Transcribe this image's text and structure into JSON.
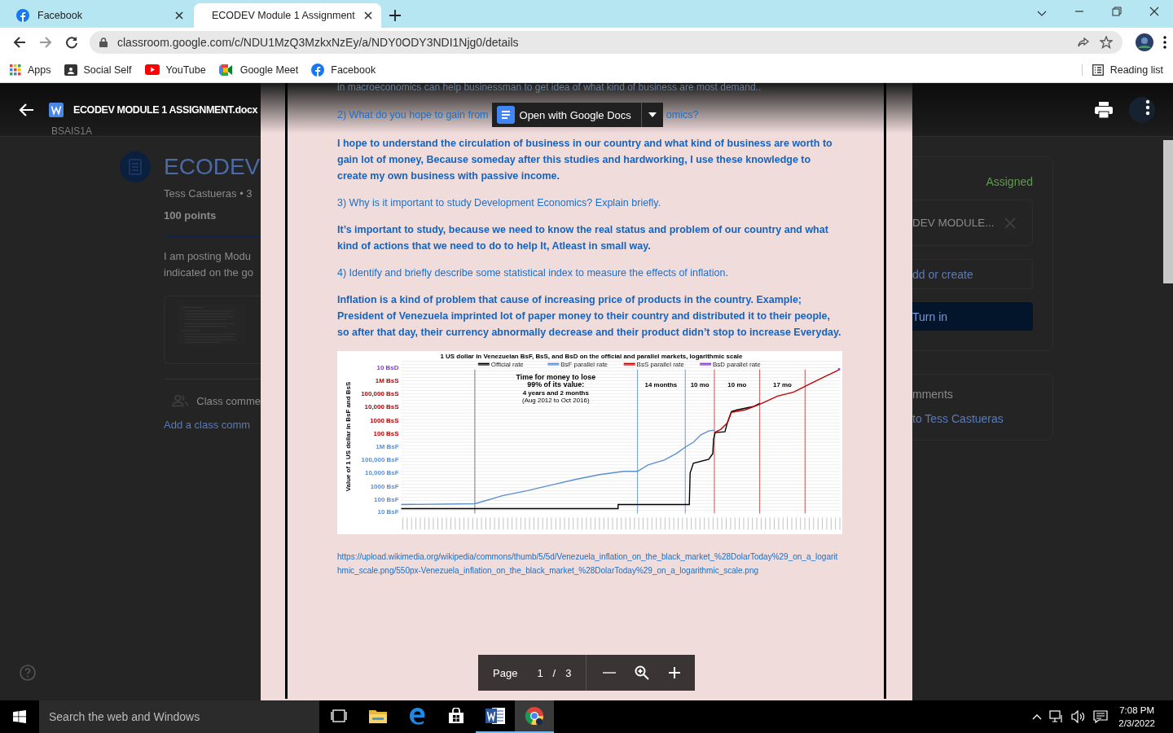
{
  "browser": {
    "tabs": [
      {
        "title": "Facebook",
        "kind": "facebook",
        "selected": false
      },
      {
        "title": "ECODEV Module 1 Assignment",
        "kind": "classroom",
        "selected": true
      }
    ],
    "url": "classroom.google.com/c/NDU1MzQ3MzkxNzEy/a/NDY0ODY3NDI1Njg0/details",
    "bookmarks": [
      {
        "label": "Apps",
        "kind": "apps"
      },
      {
        "label": "Social Self",
        "kind": "page"
      },
      {
        "label": "YouTube",
        "kind": "youtube"
      },
      {
        "label": "Google Meet",
        "kind": "meet"
      },
      {
        "label": "Facebook",
        "kind": "facebook"
      }
    ],
    "reading_list": "Reading list"
  },
  "classroom": {
    "class_code": "BSAIS1A",
    "title": "ECODEV",
    "meta": "Tess Castueras • 3",
    "points": "100 points",
    "description": [
      "I am posting Modu",
      "indicated on the go"
    ],
    "class_comments": "Class comme",
    "add_comment": "Add a class comm",
    "status": "Assigned",
    "attachment": "DEV MODULE...",
    "add_or_create": "dd or create",
    "turn_in": "Turn in",
    "private_comments": "mments",
    "private_to": "to Tess Castueras"
  },
  "viewer": {
    "file_name": "ECODEV MODULE 1 ASSIGNMENT.docx",
    "open_with": "Open with Google Docs",
    "paragraphs": [
      {
        "kind": "answer",
        "text": "in macroeconomics can help businessman to get idea of what kind of business are most demand.."
      },
      {
        "kind": "question_with_button",
        "text": "2) What do you hope to gain from",
        "text_after": "omics?"
      },
      {
        "kind": "answer",
        "text": "I hope to understand the circulation of business in our country and what kind of business are worth to gain lot of money, Because someday after this studies and hardworking, I use these knowledge to create my own business with passive income."
      },
      {
        "kind": "question",
        "text": "3) Why is it important to study Development Economics? Explain briefly."
      },
      {
        "kind": "answer",
        "text": "It’s important to study, because we need to know the real status and problem of our country and what kind of actions that we need to do to help It,  Atleast in small way."
      },
      {
        "kind": "question",
        "text": "4) Identify and briefly describe some statistical index to measure the effects of inflation."
      },
      {
        "kind": "answer",
        "text": "Inflation is a kind of problem that cause of increasing price of products in the country. Example; President of Venezuela imprinted lot of paper money to their country and distributed it to their people, so after that day, their currency abnormally  decrease and their product didn’t stop to increase Everyday."
      }
    ],
    "chart_image": {
      "title": "1 US dollar in Venezuelan BsF, BsS, and BsD on the official and parallel markets, logarithmic scale",
      "legend": [
        {
          "label": "Official rate",
          "color": "#000000"
        },
        {
          "label": "BsF parallel rate",
          "color": "#5b8fd0"
        },
        {
          "label": "BsS parallel rate",
          "color": "#c00000"
        },
        {
          "label": "BsD parallel rate",
          "color": "#8040c0"
        }
      ],
      "y_labels": [
        {
          "label": "10 BsD",
          "color": "#8040c0"
        },
        {
          "label": "1M BsS",
          "color": "#c00000"
        },
        {
          "label": "100,000 BsS",
          "color": "#c00000"
        },
        {
          "label": "10,000 BsS",
          "color": "#c00000"
        },
        {
          "label": "1000 BsS",
          "color": "#c00000"
        },
        {
          "label": "100 BsS",
          "color": "#c00000"
        },
        {
          "label": "1M BsF",
          "color": "#5b8fd0"
        },
        {
          "label": "100,000 BsF",
          "color": "#5b8fd0"
        },
        {
          "label": "10,000 BsF",
          "color": "#5b8fd0"
        },
        {
          "label": "1000 BsF",
          "color": "#5b8fd0"
        },
        {
          "label": "100 BsF",
          "color": "#5b8fd0"
        },
        {
          "label": "10 BsF",
          "color": "#5b8fd0"
        }
      ],
      "y_axis_label": "Value of 1 US dollar in BsF and BsS",
      "note_lines": [
        "Time for money to lose",
        "99% of its value:",
        "4 years and 2 months",
        "(Aug 2012 to Oct 2016)"
      ],
      "period_labels": [
        "14 months",
        "10 mo",
        "10 mo",
        "17 mo"
      ]
    },
    "source_link": "https://upload.wikimedia.org/wikipedia/commons/thumb/5/5d/Venezuela_inflation_on_the_black_market_%28DolarToday%29_on_a_logarithmic_scale.png/550px-Venezuela_inflation_on_the_black_market_%28DolarToday%29_on_a_logarithmic_scale.png",
    "pager": {
      "label": "Page",
      "current": "1",
      "separator": "/",
      "total": "3"
    }
  },
  "taskbar": {
    "search_placeholder": "Search the web and Windows",
    "apps": [
      {
        "kind": "task_view",
        "open": false,
        "selected": false
      },
      {
        "kind": "explorer",
        "open": false,
        "selected": false
      },
      {
        "kind": "edge",
        "open": false,
        "selected": false
      },
      {
        "kind": "store",
        "open": false,
        "selected": false
      },
      {
        "kind": "word",
        "open": true,
        "selected": false
      },
      {
        "kind": "chrome",
        "open": true,
        "selected": true
      }
    ],
    "time": "7:08 PM",
    "date": "2/3/2022"
  }
}
